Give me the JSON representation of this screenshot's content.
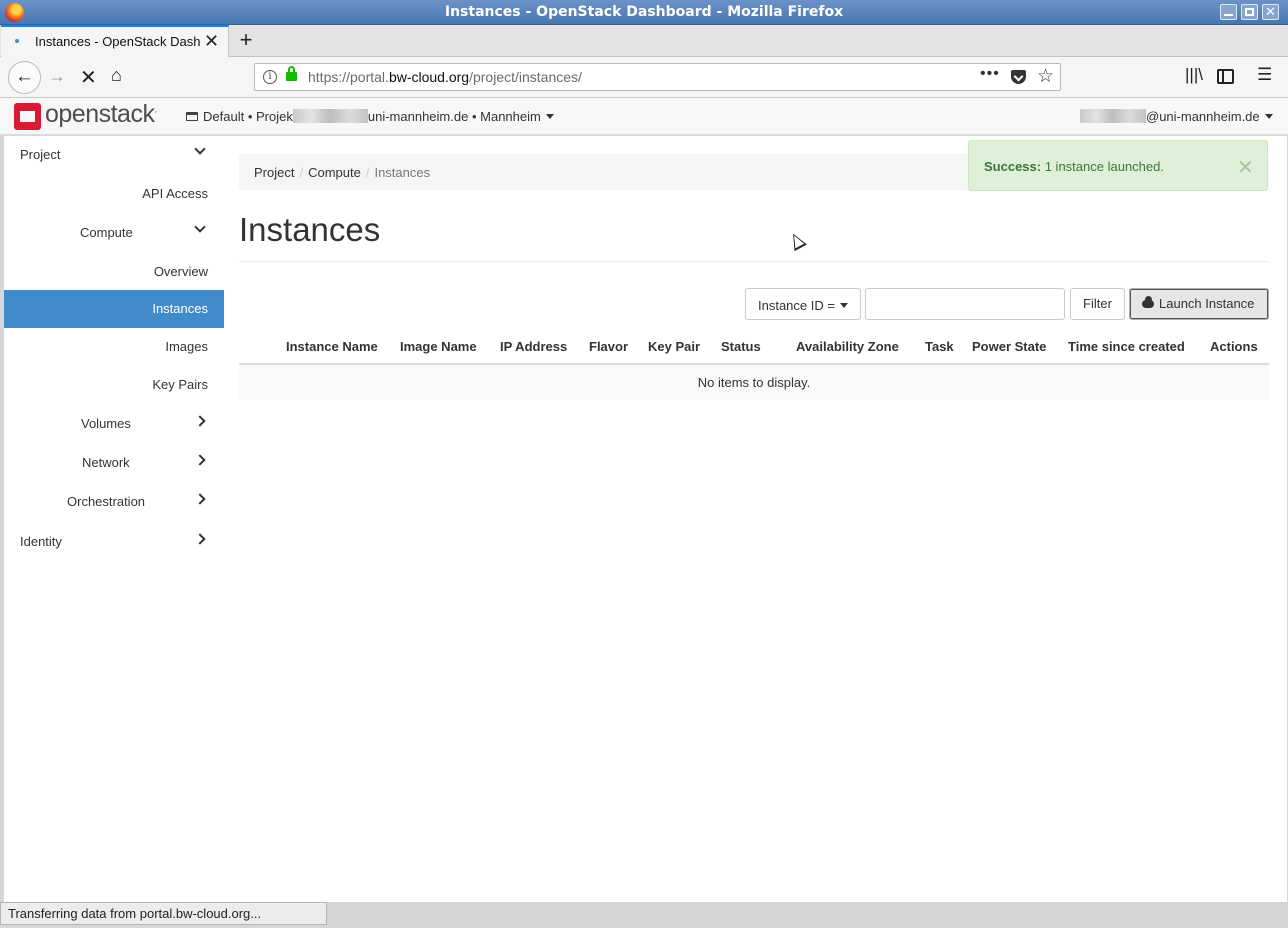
{
  "window": {
    "title": "Instances - OpenStack Dashboard - Mozilla Firefox"
  },
  "tab": {
    "title": "Instances - OpenStack Dashboard",
    "close_glyph": "✕",
    "new_tab_glyph": "+"
  },
  "navbar": {
    "url_prefix": "https://portal.",
    "url_domain": "bw-cloud.org",
    "url_path": "/project/instances/",
    "more_glyph": "•••",
    "star_glyph": "☆"
  },
  "header": {
    "logo_text": "openstack",
    "project_domain": "Default",
    "project_prefix": "Projek",
    "project_suffix": "uni-mannheim.de",
    "region": "Mannheim",
    "user_suffix": "@uni-mannheim.de",
    "separator": "•"
  },
  "sidebar": {
    "items": [
      {
        "label": "Project"
      },
      {
        "label": "API Access"
      },
      {
        "label": "Compute"
      },
      {
        "label": "Overview"
      },
      {
        "label": "Instances"
      },
      {
        "label": "Images"
      },
      {
        "label": "Key Pairs"
      },
      {
        "label": "Volumes"
      },
      {
        "label": "Network"
      },
      {
        "label": "Orchestration"
      },
      {
        "label": "Identity"
      }
    ]
  },
  "breadcrumb": {
    "items": [
      "Project",
      "Compute",
      "Instances"
    ],
    "separator": "/"
  },
  "alert": {
    "strong": "Success:",
    "message": "1 instance launched.",
    "close_glyph": "✕"
  },
  "page": {
    "title": "Instances"
  },
  "filter": {
    "select_label": "Instance ID =",
    "input_value": "",
    "button_label": "Filter"
  },
  "actions": {
    "launch_label": "Launch Instance"
  },
  "table": {
    "columns": [
      "Instance Name",
      "Image Name",
      "IP Address",
      "Flavor",
      "Key Pair",
      "Status",
      "Availability Zone",
      "Task",
      "Power State",
      "Time since created",
      "Actions"
    ],
    "empty_message": "No items to display."
  },
  "statusbar": {
    "text": "Transferring data from portal.bw-cloud.org..."
  }
}
